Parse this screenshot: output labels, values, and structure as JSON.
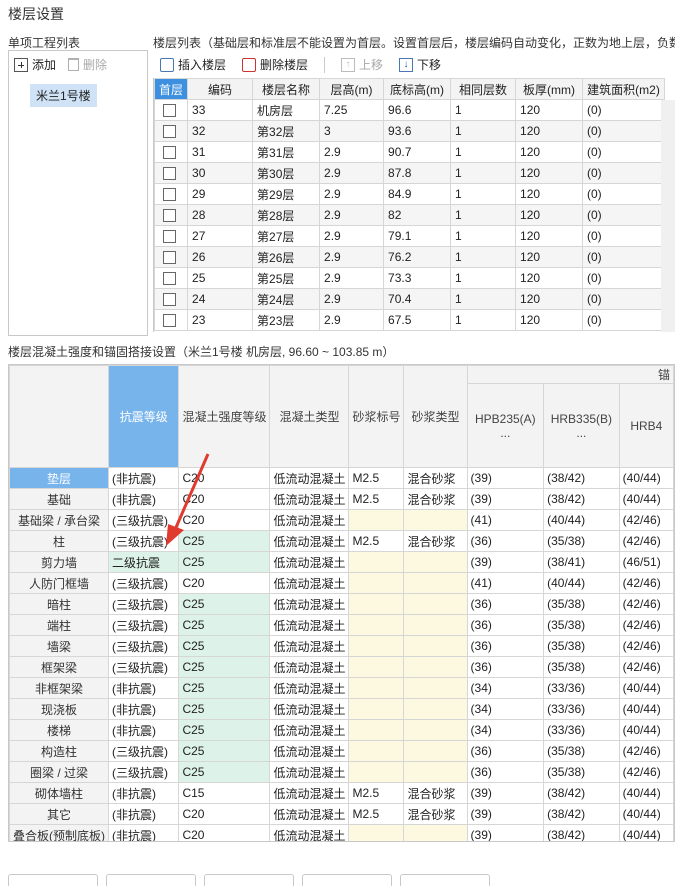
{
  "window": {
    "title": "楼层设置"
  },
  "left_panel": {
    "label": "单项工程列表",
    "add_label": "添加",
    "delete_label": "删除",
    "project_item": "米兰1号楼"
  },
  "floor_panel": {
    "label": "楼层列表（基础层和标准层不能设置为首层。设置首层后，楼层编码自动变化，正数为地上层，负数",
    "toolbar": {
      "insert_label": "插入楼层",
      "delete_label": "删除楼层",
      "up_label": "上移",
      "down_label": "下移"
    },
    "columns": [
      "首层",
      "编码",
      "楼层名称",
      "层高(m)",
      "底标高(m)",
      "相同层数",
      "板厚(mm)",
      "建筑面积(m2)"
    ],
    "rows": [
      [
        "33",
        "机房层",
        "7.25",
        "96.6",
        "1",
        "120",
        "(0)"
      ],
      [
        "32",
        "第32层",
        "3",
        "93.6",
        "1",
        "120",
        "(0)"
      ],
      [
        "31",
        "第31层",
        "2.9",
        "90.7",
        "1",
        "120",
        "(0)"
      ],
      [
        "30",
        "第30层",
        "2.9",
        "87.8",
        "1",
        "120",
        "(0)"
      ],
      [
        "29",
        "第29层",
        "2.9",
        "84.9",
        "1",
        "120",
        "(0)"
      ],
      [
        "28",
        "第28层",
        "2.9",
        "82",
        "1",
        "120",
        "(0)"
      ],
      [
        "27",
        "第27层",
        "2.9",
        "79.1",
        "1",
        "120",
        "(0)"
      ],
      [
        "26",
        "第26层",
        "2.9",
        "76.2",
        "1",
        "120",
        "(0)"
      ],
      [
        "25",
        "第25层",
        "2.9",
        "73.3",
        "1",
        "120",
        "(0)"
      ],
      [
        "24",
        "第24层",
        "2.9",
        "70.4",
        "1",
        "120",
        "(0)"
      ],
      [
        "23",
        "第23层",
        "2.9",
        "67.5",
        "1",
        "120",
        "(0)"
      ]
    ]
  },
  "concrete_panel": {
    "label": "楼层混凝土强度和锚固搭接设置（米兰1号楼 机房层, 96.60 ~ 103.85 m）",
    "group_header": "锚",
    "columns": [
      "抗震等级",
      "混凝土强度等级",
      "混凝土类型",
      "砂浆标号",
      "砂浆类型",
      "HPB235(A) ...",
      "HRB335(B) ...",
      "HRB4"
    ],
    "rows": [
      {
        "name": "垫层",
        "seismic": "(非抗震)",
        "grade": "C20",
        "type": "低流动混凝土",
        "mortar": "M2.5",
        "mortar_type": "混合砂浆",
        "a": "(39)",
        "b": "(38/42)",
        "c": "(40/44)"
      },
      {
        "name": "基础",
        "seismic": "(非抗震)",
        "grade": "C20",
        "type": "低流动混凝土",
        "mortar": "M2.5",
        "mortar_type": "混合砂浆",
        "a": "(39)",
        "b": "(38/42)",
        "c": "(40/44)"
      },
      {
        "name": "基础梁 / 承台梁",
        "seismic": "(三级抗震)",
        "grade": "C20",
        "type": "低流动混凝土",
        "mortar": "",
        "mortar_type": "",
        "a": "(41)",
        "b": "(40/44)",
        "c": "(42/46)"
      },
      {
        "name": "柱",
        "seismic": "(三级抗震)",
        "grade": "C25",
        "type": "低流动混凝土",
        "mortar": "M2.5",
        "mortar_type": "混合砂浆",
        "a": "(36)",
        "b": "(35/38)",
        "c": "(42/46)"
      },
      {
        "name": "剪力墙",
        "seismic": "二级抗震",
        "grade": "C25",
        "type": "低流动混凝土",
        "mortar": "",
        "mortar_type": "",
        "a": "(39)",
        "b": "(38/41)",
        "c": "(46/51)"
      },
      {
        "name": "人防门框墙",
        "seismic": "(三级抗震)",
        "grade": "C20",
        "type": "低流动混凝土",
        "mortar": "",
        "mortar_type": "",
        "a": "(41)",
        "b": "(40/44)",
        "c": "(42/46)"
      },
      {
        "name": "暗柱",
        "seismic": "(三级抗震)",
        "grade": "C25",
        "type": "低流动混凝土",
        "mortar": "",
        "mortar_type": "",
        "a": "(36)",
        "b": "(35/38)",
        "c": "(42/46)"
      },
      {
        "name": "端柱",
        "seismic": "(三级抗震)",
        "grade": "C25",
        "type": "低流动混凝土",
        "mortar": "",
        "mortar_type": "",
        "a": "(36)",
        "b": "(35/38)",
        "c": "(42/46)"
      },
      {
        "name": "墙梁",
        "seismic": "(三级抗震)",
        "grade": "C25",
        "type": "低流动混凝土",
        "mortar": "",
        "mortar_type": "",
        "a": "(36)",
        "b": "(35/38)",
        "c": "(42/46)"
      },
      {
        "name": "框架梁",
        "seismic": "(三级抗震)",
        "grade": "C25",
        "type": "低流动混凝土",
        "mortar": "",
        "mortar_type": "",
        "a": "(36)",
        "b": "(35/38)",
        "c": "(42/46)"
      },
      {
        "name": "非框架梁",
        "seismic": "(非抗震)",
        "grade": "C25",
        "type": "低流动混凝土",
        "mortar": "",
        "mortar_type": "",
        "a": "(34)",
        "b": "(33/36)",
        "c": "(40/44)"
      },
      {
        "name": "现浇板",
        "seismic": "(非抗震)",
        "grade": "C25",
        "type": "低流动混凝土",
        "mortar": "",
        "mortar_type": "",
        "a": "(34)",
        "b": "(33/36)",
        "c": "(40/44)"
      },
      {
        "name": "楼梯",
        "seismic": "(非抗震)",
        "grade": "C25",
        "type": "低流动混凝土",
        "mortar": "",
        "mortar_type": "",
        "a": "(34)",
        "b": "(33/36)",
        "c": "(40/44)"
      },
      {
        "name": "构造柱",
        "seismic": "(三级抗震)",
        "grade": "C25",
        "type": "低流动混凝土",
        "mortar": "",
        "mortar_type": "",
        "a": "(36)",
        "b": "(35/38)",
        "c": "(42/46)"
      },
      {
        "name": "圈梁 / 过梁",
        "seismic": "(三级抗震)",
        "grade": "C25",
        "type": "低流动混凝土",
        "mortar": "",
        "mortar_type": "",
        "a": "(36)",
        "b": "(35/38)",
        "c": "(42/46)"
      },
      {
        "name": "砌体墙柱",
        "seismic": "(非抗震)",
        "grade": "C15",
        "type": "低流动混凝土",
        "mortar": "M2.5",
        "mortar_type": "混合砂浆",
        "a": "(39)",
        "b": "(38/42)",
        "c": "(40/44)"
      },
      {
        "name": "其它",
        "seismic": "(非抗震)",
        "grade": "C20",
        "type": "低流动混凝土",
        "mortar": "M2.5",
        "mortar_type": "混合砂浆",
        "a": "(39)",
        "b": "(38/42)",
        "c": "(40/44)"
      },
      {
        "name": "叠合板(预制底板)",
        "seismic": "(非抗震)",
        "grade": "C20",
        "type": "低流动混凝土",
        "mortar": "",
        "mortar_type": "",
        "a": "(39)",
        "b": "(38/42)",
        "c": "(40/44)"
      }
    ]
  },
  "colors": {
    "accent": "#3d8fe0",
    "seismic_header": "#78b4ec",
    "green_cell": "#ddf3e9",
    "yellow_cell": "#fdf9e0",
    "annotation_arrow": "#e03a2f"
  }
}
